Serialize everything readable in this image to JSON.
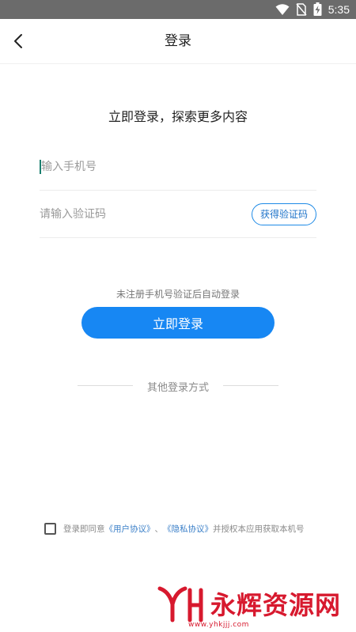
{
  "status_bar": {
    "time": "5:35",
    "icons": [
      "wifi-icon",
      "no-sim-icon",
      "battery-charging-icon"
    ],
    "background": "#6b6b6b"
  },
  "nav": {
    "title": "登录",
    "back_icon": "chevron-left-icon"
  },
  "headline": "立即登录，探索更多内容",
  "phone_field": {
    "placeholder": "输入手机号",
    "value": ""
  },
  "code_field": {
    "placeholder": "请输入验证码",
    "value": "",
    "get_code_label": "获得验证码"
  },
  "hint": "未注册手机号验证后自动登录",
  "login_button_label": "立即登录",
  "other_login_label": "其他登录方式",
  "agreement": {
    "checked": false,
    "prefix": "登录即同意",
    "user_agreement": "《用户协议》",
    "separator": "、",
    "privacy_agreement": "《隐私协议》",
    "suffix": "并授权本应用获取本机号"
  },
  "watermark": {
    "name": "永辉资源网",
    "url": "www.yhkjjj.com"
  },
  "colors": {
    "accent": "#1787f3",
    "link": "#3a7fc8",
    "watermark": "#d7192e"
  }
}
